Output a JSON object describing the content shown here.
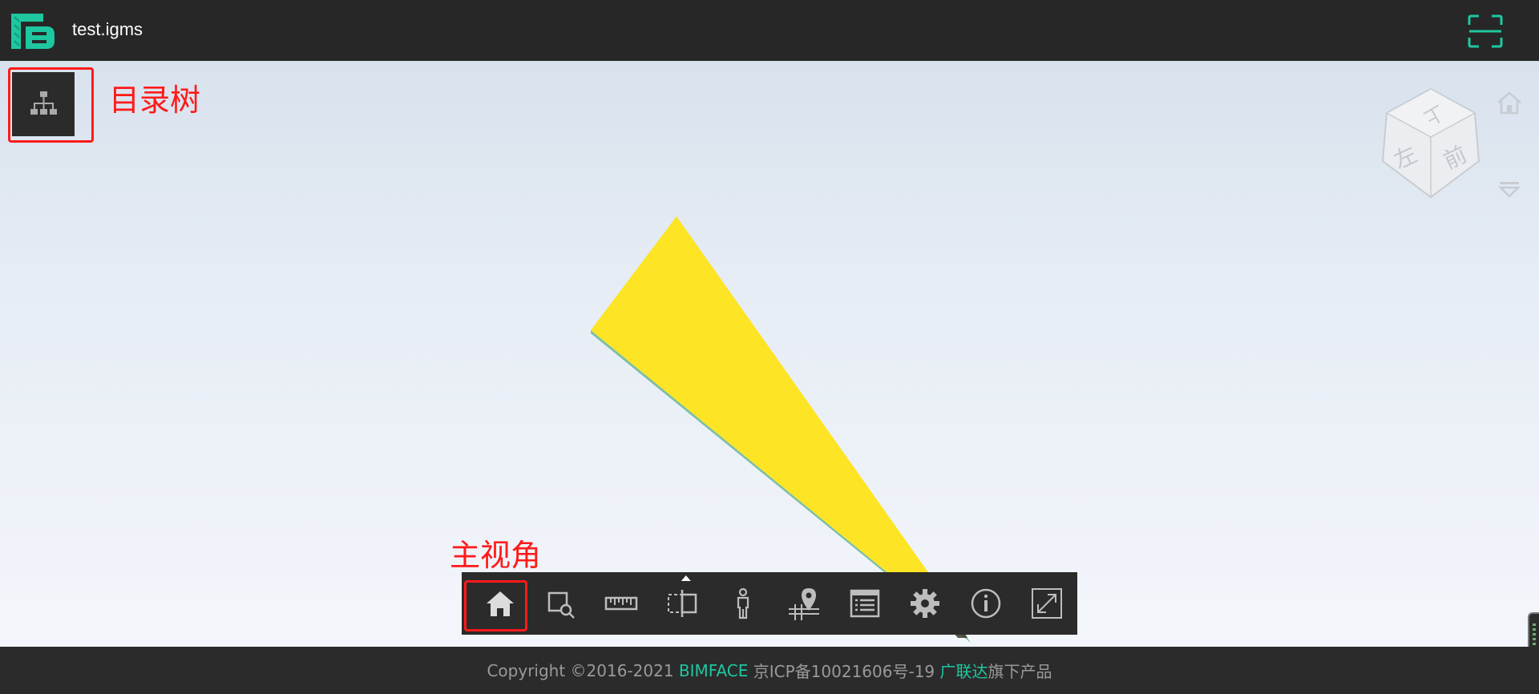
{
  "header": {
    "file_name": "test.igms",
    "logo_icon": "bimface-logo-icon",
    "scan_icon": "scan-frame-icon"
  },
  "annotations": {
    "tree_label": "目录树",
    "home_label": "主视角"
  },
  "viewcube": {
    "faces": {
      "top": "上",
      "left": "左",
      "front": "前"
    }
  },
  "toolbar": {
    "tools": [
      {
        "icon": "home-icon",
        "name": "home-view"
      },
      {
        "icon": "box-zoom-icon",
        "name": "box-zoom"
      },
      {
        "icon": "ruler-icon",
        "name": "measure"
      },
      {
        "icon": "section-box-icon",
        "name": "section"
      },
      {
        "icon": "walk-person-icon",
        "name": "walk-mode"
      },
      {
        "icon": "map-pin-icon",
        "name": "map-mode"
      },
      {
        "icon": "properties-list-icon",
        "name": "properties"
      },
      {
        "icon": "gear-icon",
        "name": "settings"
      },
      {
        "icon": "info-icon",
        "name": "info"
      },
      {
        "icon": "fullscreen-icon",
        "name": "fullscreen"
      }
    ]
  },
  "footer": {
    "copyright": "Copyright ©2016-2021 ",
    "brand": "BIMFACE",
    "icp": " 京ICP备10021606号-19 ",
    "company": "广联达",
    "suffix": "旗下产品"
  },
  "colors": {
    "accent": "#1ec7a0",
    "annotation": "#ff1a1a",
    "model_yellow": "#fde424",
    "bar_dark": "#2b2b2b"
  }
}
